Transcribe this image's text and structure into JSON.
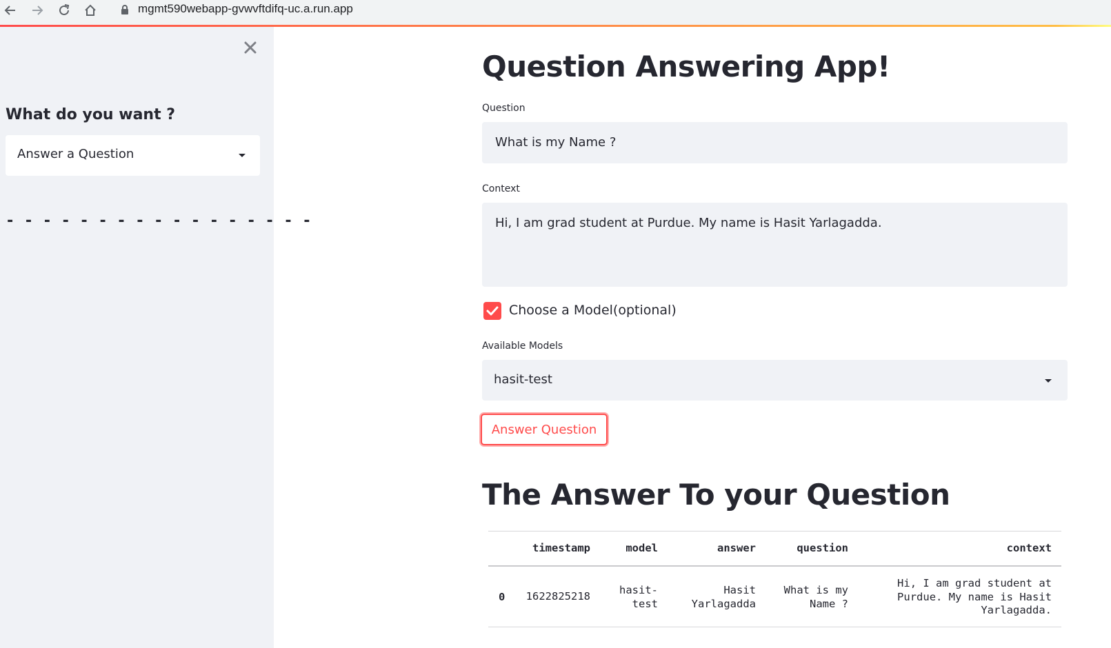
{
  "browser": {
    "url": "mgmt590webapp-gvwvftdifq-uc.a.run.app",
    "icons": [
      "back-arrow-icon",
      "forward-arrow-icon",
      "reload-icon",
      "home-icon",
      "lock-icon"
    ]
  },
  "colors": {
    "accent": "#ff4b4b",
    "sidebar_bg": "#f0f2f6",
    "text": "#262730"
  },
  "sidebar": {
    "heading": "What do you want ?",
    "select_value": "Answer a Question",
    "dashes": "- - - - - - - - - - - - - - - - -"
  },
  "main": {
    "title": "Question Answering App!",
    "question_label": "Question",
    "question_value": "What is my Name ?",
    "context_label": "Context",
    "context_value": "Hi, I am grad student at Purdue. My name is Hasit Yarlagadda.",
    "checkbox_label": "Choose a Model(optional)",
    "checkbox_checked": true,
    "models_label": "Available Models",
    "model_value": "hasit-test",
    "button_label": "Answer Question",
    "answer_heading": "The Answer To your Question"
  },
  "table": {
    "columns": [
      "timestamp",
      "model",
      "answer",
      "question",
      "context"
    ],
    "rows": [
      {
        "index": "0",
        "timestamp": "1622825218",
        "model": [
          "hasit-",
          "test"
        ],
        "answer": [
          "Hasit",
          "Yarlagadda"
        ],
        "question": [
          "What is my",
          "Name ?"
        ],
        "context": [
          "Hi, I am grad student at",
          "Purdue. My name is Hasit",
          "Yarlagadda."
        ]
      }
    ]
  }
}
